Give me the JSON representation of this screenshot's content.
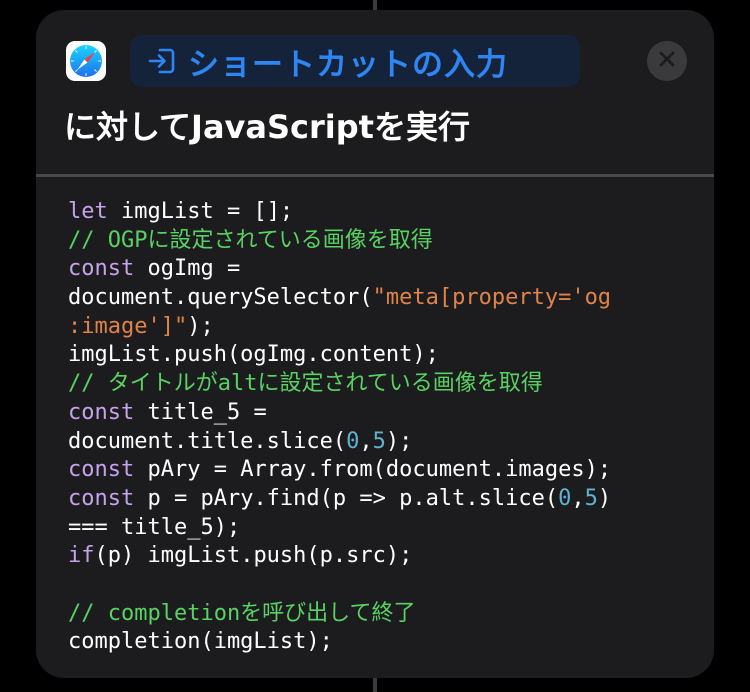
{
  "action": {
    "input_chip_label": "ショートカットの入力",
    "title": "に対してJavaScriptを実行",
    "app_icon": "safari-compass-icon",
    "close_icon": "close-icon"
  },
  "colors": {
    "background": "#000000",
    "card": "#1c1c1e",
    "accent": "#2e86f5",
    "keyword": "#c7a2ec",
    "comment": "#58d263",
    "string": "#e0834a",
    "number": "#5fb3d2",
    "text": "#ffffff"
  },
  "code": {
    "lines": [
      [
        {
          "t": "let",
          "c": "kw"
        },
        {
          "t": " imgList = [];",
          "c": ""
        }
      ],
      [
        {
          "t": "// OGPに設定されている画像を取得",
          "c": "cm"
        }
      ],
      [
        {
          "t": "const",
          "c": "kw"
        },
        {
          "t": " ogImg =",
          "c": ""
        }
      ],
      [
        {
          "t": "document.querySelector(",
          "c": ""
        },
        {
          "t": "\"meta[property='og",
          "c": "str"
        }
      ],
      [
        {
          "t": ":image']\"",
          "c": "str"
        },
        {
          "t": ");",
          "c": ""
        }
      ],
      [
        {
          "t": "imgList.push(ogImg.content);",
          "c": ""
        }
      ],
      [
        {
          "t": "// タイトルがaltに設定されている画像を取得",
          "c": "cm"
        }
      ],
      [
        {
          "t": "const",
          "c": "kw"
        },
        {
          "t": " title_5 =",
          "c": ""
        }
      ],
      [
        {
          "t": "document.title.slice(",
          "c": ""
        },
        {
          "t": "0",
          "c": "num"
        },
        {
          "t": ",",
          "c": ""
        },
        {
          "t": "5",
          "c": "num"
        },
        {
          "t": ");",
          "c": ""
        }
      ],
      [
        {
          "t": "const",
          "c": "kw"
        },
        {
          "t": " pAry = Array.from(document.images);",
          "c": ""
        }
      ],
      [
        {
          "t": "const",
          "c": "kw"
        },
        {
          "t": " p = pAry.find(p => p.alt.slice(",
          "c": ""
        },
        {
          "t": "0",
          "c": "num"
        },
        {
          "t": ",",
          "c": ""
        },
        {
          "t": "5",
          "c": "num"
        },
        {
          "t": ")",
          "c": ""
        }
      ],
      [
        {
          "t": "=== title_5);",
          "c": ""
        }
      ],
      [
        {
          "t": "if",
          "c": "kw"
        },
        {
          "t": "(p) imgList.push(p.src);",
          "c": ""
        }
      ],
      [],
      [
        {
          "t": "// completionを呼び出して終了",
          "c": "cm"
        }
      ],
      [
        {
          "t": "completion(imgList);",
          "c": ""
        }
      ]
    ]
  }
}
